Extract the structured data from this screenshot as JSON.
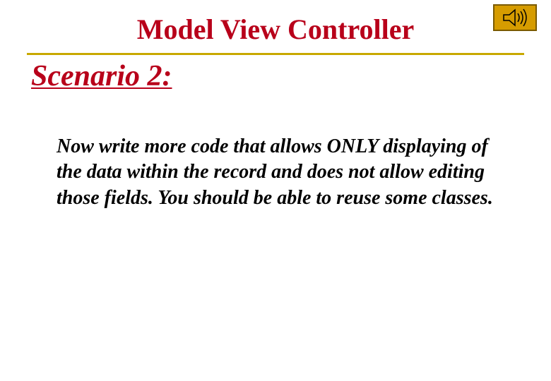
{
  "title": "Model View Controller",
  "subtitle": "Scenario 2:",
  "body": "Now write more code that allows ONLY displaying of the data within the record and does not allow editing those fields.  You should be able to reuse some classes.",
  "colors": {
    "accent_red": "#b8001a",
    "divider_gold": "#c8a800",
    "icon_bg": "#d69c00"
  }
}
